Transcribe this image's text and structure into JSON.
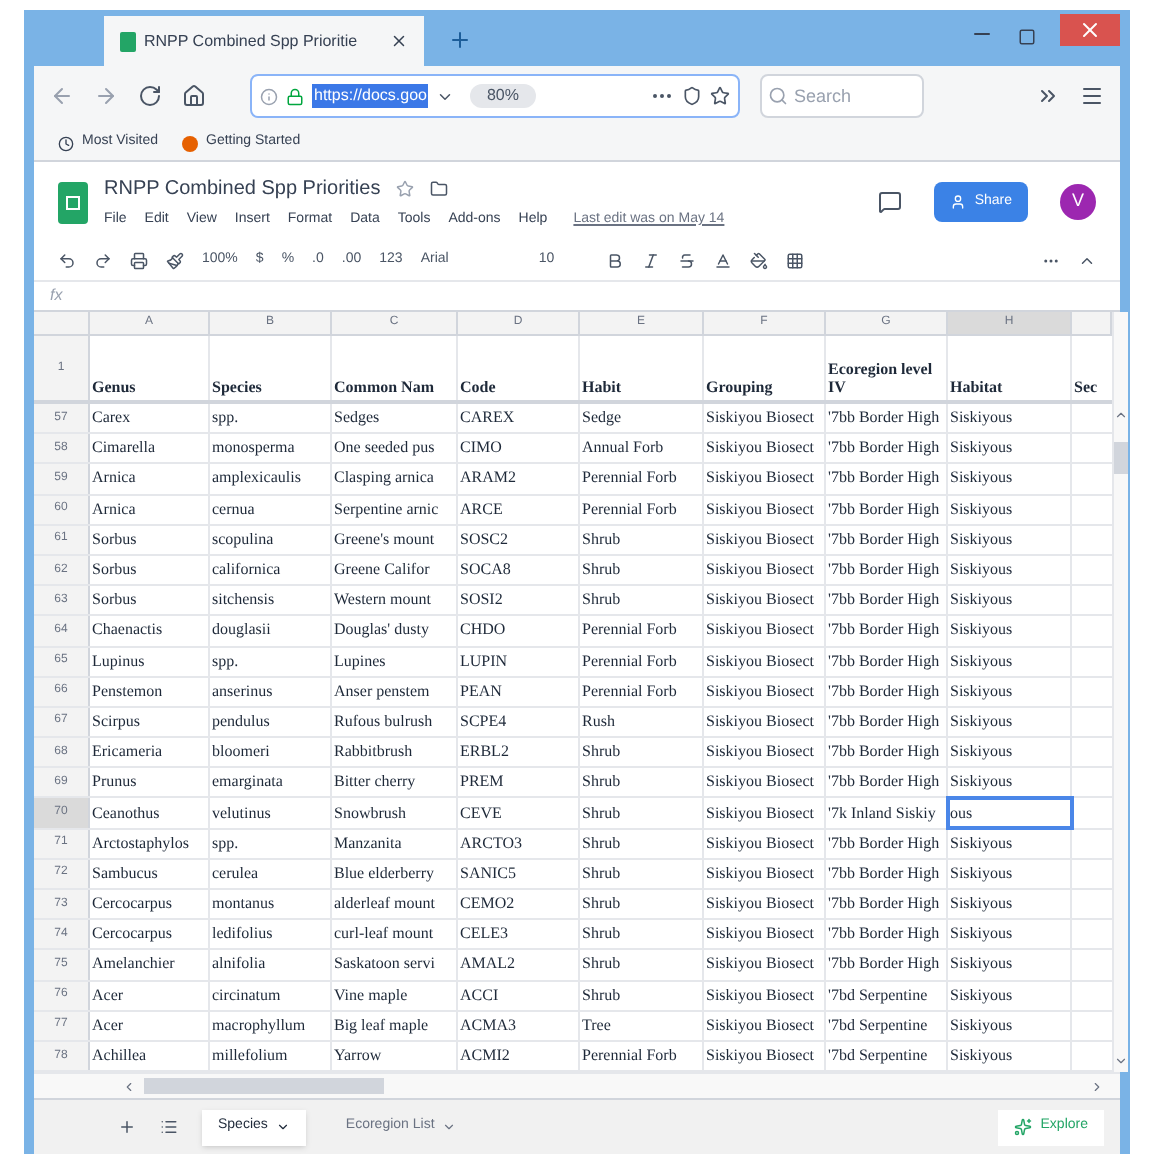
{
  "browser": {
    "tab_title": "RNPP Combined Spp Prioritie",
    "url": "https://docs.goo",
    "zoom": "80%",
    "search_placeholder": "Search",
    "bookmarks": [
      "Most Visited",
      "Getting Started"
    ]
  },
  "sheets": {
    "title": "RNPP Combined Spp Priorities",
    "menus": [
      "File",
      "Edit",
      "View",
      "Insert",
      "Format",
      "Data",
      "Tools",
      "Add-ons",
      "Help"
    ],
    "last_edit": "Last edit was on May 14",
    "share": "Share",
    "avatar": "V",
    "toolbar": {
      "zoom": "100%",
      "currency": "$",
      "percent": "%",
      "dec_less": ".0",
      "dec_more": ".00",
      "format": "123",
      "font": "Arial",
      "size": "10"
    },
    "formula_label": "fx"
  },
  "grid": {
    "columns": [
      {
        "letter": "A",
        "header": "Genus",
        "selected": false
      },
      {
        "letter": "B",
        "header": "Species",
        "selected": false
      },
      {
        "letter": "C",
        "header": "Common Nam",
        "selected": false
      },
      {
        "letter": "D",
        "header": "Code",
        "selected": false
      },
      {
        "letter": "E",
        "header": "Habit",
        "selected": false
      },
      {
        "letter": "F",
        "header": "Grouping",
        "selected": false
      },
      {
        "letter": "G",
        "header": "Ecoregion level IV",
        "selected": false
      },
      {
        "letter": "H",
        "header": "Habitat",
        "selected": true
      },
      {
        "header": "Sec",
        "selected": false
      }
    ],
    "header_row_number": "1",
    "rows": [
      {
        "number": "57",
        "selected": false,
        "cells": [
          "Carex",
          "spp.",
          "Sedges",
          "CAREX",
          "Sedge",
          "Siskiyou Biosect",
          "'7bb Border High",
          "Siskiyous"
        ]
      },
      {
        "number": "58",
        "selected": false,
        "cells": [
          "Cimarella",
          "monosperma",
          "One seeded pus",
          "CIMO",
          "Annual Forb",
          "Siskiyou Biosect",
          "'7bb Border High",
          "Siskiyous"
        ]
      },
      {
        "number": "59",
        "selected": false,
        "cells": [
          "Arnica",
          "amplexicaulis",
          "Clasping arnica",
          "ARAM2",
          "Perennial Forb",
          "Siskiyou Biosect",
          "'7bb Border High",
          "Siskiyous"
        ]
      },
      {
        "number": "60",
        "selected": false,
        "cells": [
          "Arnica",
          "cernua",
          "Serpentine arnic",
          "ARCE",
          "Perennial Forb",
          "Siskiyou Biosect",
          "'7bb Border High",
          "Siskiyous"
        ]
      },
      {
        "number": "61",
        "selected": false,
        "cells": [
          "Sorbus",
          "scopulina",
          "Greene's mount",
          "SOSC2",
          "Shrub",
          "Siskiyou Biosect",
          "'7bb Border High",
          "Siskiyous"
        ]
      },
      {
        "number": "62",
        "selected": false,
        "cells": [
          "Sorbus",
          "californica",
          "Greene Califor",
          "SOCA8",
          "Shrub",
          "Siskiyou Biosect",
          "'7bb Border High",
          "Siskiyous"
        ]
      },
      {
        "number": "63",
        "selected": false,
        "cells": [
          "Sorbus",
          "sitchensis",
          "Western mount",
          "SOSI2",
          "Shrub",
          "Siskiyou Biosect",
          "'7bb Border High",
          "Siskiyous"
        ]
      },
      {
        "number": "64",
        "selected": false,
        "cells": [
          "Chaenactis",
          "douglasii",
          "Douglas' dusty",
          "CHDO",
          "Perennial Forb",
          "Siskiyou Biosect",
          "'7bb Border High",
          "Siskiyous"
        ]
      },
      {
        "number": "65",
        "selected": false,
        "cells": [
          "Lupinus",
          "spp.",
          "Lupines",
          "LUPIN",
          "Perennial Forb",
          "Siskiyou Biosect",
          "'7bb Border High",
          "Siskiyous"
        ]
      },
      {
        "number": "66",
        "selected": false,
        "cells": [
          "Penstemon",
          "anserinus",
          "Anser penstem",
          "PEAN",
          "Perennial Forb",
          "Siskiyou Biosect",
          "'7bb Border High",
          "Siskiyous"
        ]
      },
      {
        "number": "67",
        "selected": false,
        "cells": [
          "Scirpus",
          "pendulus",
          "Rufous bulrush",
          "SCPE4",
          "Rush",
          "Siskiyou Biosect",
          "'7bb Border High",
          "Siskiyous"
        ]
      },
      {
        "number": "68",
        "selected": false,
        "cells": [
          "Ericameria",
          "bloomeri",
          "Rabbitbrush",
          "ERBL2",
          "Shrub",
          "Siskiyou Biosect",
          "'7bb Border High",
          "Siskiyous"
        ]
      },
      {
        "number": "69",
        "selected": false,
        "cells": [
          "Prunus",
          "emarginata",
          "Bitter cherry",
          "PREM",
          "Shrub",
          "Siskiyou Biosect",
          "'7bb Border High",
          "Siskiyous"
        ]
      },
      {
        "number": "70",
        "selected": true,
        "cells": [
          "Ceanothus",
          "velutinus",
          "Snowbrush",
          "CEVE",
          "Shrub",
          "Siskiyou Biosect",
          "'7k Inland Siskiy",
          "ous"
        ]
      },
      {
        "number": "71",
        "selected": false,
        "cells": [
          "Arctostaphylos",
          "spp.",
          "Manzanita",
          "ARCTO3",
          "Shrub",
          "Siskiyou Biosect",
          "'7bb Border High",
          "Siskiyous"
        ]
      },
      {
        "number": "72",
        "selected": false,
        "cells": [
          "Sambucus",
          "cerulea",
          "Blue elderberry",
          "SANIC5",
          "Shrub",
          "Siskiyou Biosect",
          "'7bb Border High",
          "Siskiyous"
        ]
      },
      {
        "number": "73",
        "selected": false,
        "cells": [
          "Cercocarpus",
          "montanus",
          "alderleaf mount",
          "CEMO2",
          "Shrub",
          "Siskiyou Biosect",
          "'7bb Border High",
          "Siskiyous"
        ]
      },
      {
        "number": "74",
        "selected": false,
        "cells": [
          "Cercocarpus",
          "ledifolius",
          "curl-leaf mount",
          "CELE3",
          "Shrub",
          "Siskiyou Biosect",
          "'7bb Border High",
          "Siskiyous"
        ]
      },
      {
        "number": "75",
        "selected": false,
        "cells": [
          "Amelanchier",
          "alnifolia",
          "Saskatoon servi",
          "AMAL2",
          "Shrub",
          "Siskiyou Biosect",
          "'7bb Border High",
          "Siskiyous"
        ]
      },
      {
        "number": "76",
        "selected": false,
        "cells": [
          "Acer",
          "circinatum",
          "Vine maple",
          "ACCI",
          "Shrub",
          "Siskiyou Biosect",
          "'7bd Serpentine",
          "Siskiyous"
        ]
      },
      {
        "number": "77",
        "selected": false,
        "cells": [
          "Acer",
          "macrophyllum",
          "Big leaf maple",
          "ACMA3",
          "Tree",
          "Siskiyou Biosect",
          "'7bd Serpentine",
          "Siskiyous"
        ]
      },
      {
        "number": "78",
        "selected": false,
        "cells": [
          "Achillea",
          "millefolium",
          "Yarrow",
          "ACMI2",
          "Perennial Forb",
          "Siskiyou Biosect",
          "'7bd Serpentine",
          "Siskiyous"
        ]
      }
    ]
  },
  "sheet_tabs": [
    {
      "label": "Species",
      "selected": true
    },
    {
      "label": "Ecoregion List",
      "selected": false
    }
  ],
  "explore": "Explore"
}
